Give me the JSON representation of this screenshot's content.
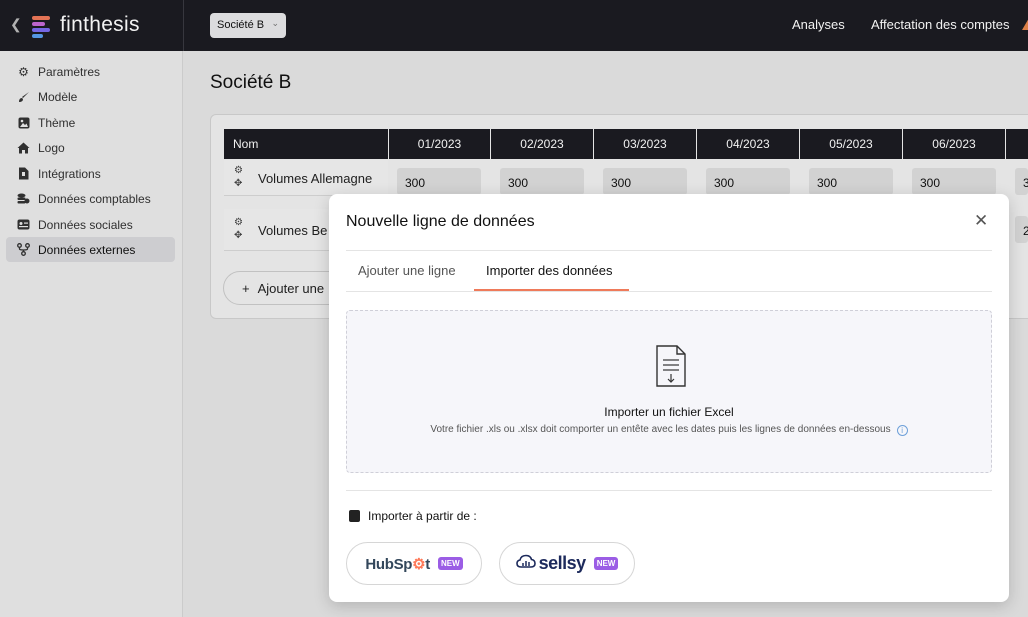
{
  "topbar": {
    "brand": "finthesis",
    "company_select": "Société B",
    "nav": [
      "Analyses",
      "Affectation des comptes"
    ]
  },
  "sidebar": {
    "items": [
      {
        "label": "Paramètres",
        "icon": "gear-icon"
      },
      {
        "label": "Modèle",
        "icon": "brush-icon"
      },
      {
        "label": "Thème",
        "icon": "image-icon"
      },
      {
        "label": "Logo",
        "icon": "home-icon"
      },
      {
        "label": "Intégrations",
        "icon": "plug-icon"
      },
      {
        "label": "Données comptables",
        "icon": "coins-icon"
      },
      {
        "label": "Données sociales",
        "icon": "id-card-icon"
      },
      {
        "label": "Données externes",
        "icon": "branch-icon",
        "active": true
      }
    ]
  },
  "main": {
    "title": "Société B",
    "table": {
      "name_header": "Nom",
      "months": [
        "01/2023",
        "02/2023",
        "03/2023",
        "04/2023",
        "05/2023",
        "06/2023"
      ],
      "rows": [
        {
          "name": "Volumes Allemagne",
          "values": [
            "300",
            "300",
            "300",
            "300",
            "300",
            "300"
          ],
          "next_partial": "3"
        },
        {
          "name": "Volumes Be",
          "next_partial": "2"
        }
      ]
    },
    "add_line_button": "Ajouter une"
  },
  "modal": {
    "title": "Nouvelle ligne de données",
    "tabs": [
      "Ajouter une ligne",
      "Importer des données"
    ],
    "active_tab": 1,
    "dropzone": {
      "title": "Importer un fichier Excel",
      "subtitle": "Votre fichier .xls ou .xlsx doit comporter un entête avec les dates puis les lignes de données en-dessous"
    },
    "import_from_label": "Importer à partir de :",
    "integrations": [
      {
        "name": "HubSpot",
        "badge": "NEW"
      },
      {
        "name": "sellsy",
        "badge": "NEW"
      }
    ]
  },
  "colors": {
    "topbar": "#1c1c22",
    "tab_underline": "#ef7a5a",
    "new_badge": "#9b5de5",
    "hubspot_orange": "#ff7a59",
    "hubspot_text": "#33475b",
    "sellsy_navy": "#1d2a5c"
  }
}
